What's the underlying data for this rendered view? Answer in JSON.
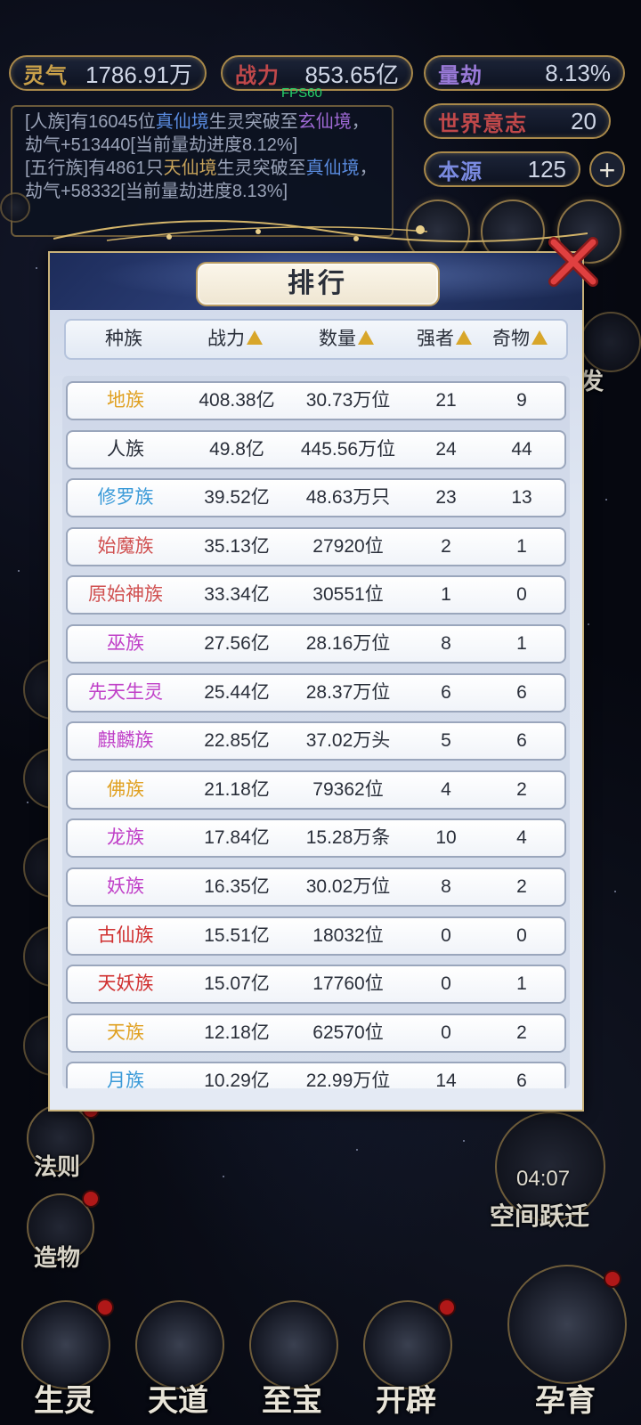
{
  "stats": {
    "lingqi": {
      "label": "灵气",
      "value": "1786.91万",
      "color": "#c8a04a"
    },
    "zhanli": {
      "label": "战力",
      "value": "853.65亿",
      "color": "#c0484a"
    },
    "liangjie": {
      "label": "量劫",
      "value": "8.13%",
      "color": "#9a7ad8"
    },
    "shijieyizhi": {
      "label": "世界意志",
      "value": "20",
      "color": "#c0484a"
    },
    "benyuan": {
      "label": "本源",
      "value": "125",
      "color": "#7a8ae0"
    },
    "fps": "FPS60"
  },
  "log": {
    "line1_a": "[人族]有16045位",
    "line1_b": "真仙境",
    "line1_c": "生灵突破至",
    "line1_d": "玄仙境",
    "line1_e": "，劫气+513440[当前量劫进度8.12%]",
    "line2_a": "[五行族]有4861只",
    "line2_b": "天仙境",
    "line2_c": "生灵突破至",
    "line2_d": "真仙境",
    "line2_e": "，劫气+58332[当前量劫进度8.13%]"
  },
  "side": {
    "fa": "发",
    "fazu": "法则",
    "zaowu": "造物",
    "timer": "04:07",
    "kongjian": "空间跃迁"
  },
  "nav": {
    "shengling": "生灵",
    "tiandao": "天道",
    "zhibao": "至宝",
    "kaipi": "开辟",
    "yunyu": "孕育"
  },
  "dialog": {
    "title": "排行",
    "headers": [
      "种族",
      "战力",
      "数量",
      "强者",
      "奇物"
    ],
    "rows": [
      {
        "name": "地族",
        "color": "#e0a020",
        "power": "408.38亿",
        "count": "30.73万位",
        "strong": "21",
        "items": "9"
      },
      {
        "name": "人族",
        "color": "#2a2f3a",
        "power": "49.8亿",
        "count": "445.56万位",
        "strong": "24",
        "items": "44"
      },
      {
        "name": "修罗族",
        "color": "#3a9ad8",
        "power": "39.52亿",
        "count": "48.63万只",
        "strong": "23",
        "items": "13"
      },
      {
        "name": "始魔族",
        "color": "#d05050",
        "power": "35.13亿",
        "count": "27920位",
        "strong": "2",
        "items": "1"
      },
      {
        "name": "原始神族",
        "color": "#d05050",
        "power": "33.34亿",
        "count": "30551位",
        "strong": "1",
        "items": "0"
      },
      {
        "name": "巫族",
        "color": "#c040c8",
        "power": "27.56亿",
        "count": "28.16万位",
        "strong": "8",
        "items": "1"
      },
      {
        "name": "先天生灵",
        "color": "#c040c8",
        "power": "25.44亿",
        "count": "28.37万位",
        "strong": "6",
        "items": "6"
      },
      {
        "name": "麒麟族",
        "color": "#c040c8",
        "power": "22.85亿",
        "count": "37.02万头",
        "strong": "5",
        "items": "6"
      },
      {
        "name": "佛族",
        "color": "#e0a020",
        "power": "21.18亿",
        "count": "79362位",
        "strong": "4",
        "items": "2"
      },
      {
        "name": "龙族",
        "color": "#c040c8",
        "power": "17.84亿",
        "count": "15.28万条",
        "strong": "10",
        "items": "4"
      },
      {
        "name": "妖族",
        "color": "#c040c8",
        "power": "16.35亿",
        "count": "30.02万位",
        "strong": "8",
        "items": "2"
      },
      {
        "name": "古仙族",
        "color": "#d03030",
        "power": "15.51亿",
        "count": "18032位",
        "strong": "0",
        "items": "0"
      },
      {
        "name": "天妖族",
        "color": "#d03030",
        "power": "15.07亿",
        "count": "17760位",
        "strong": "0",
        "items": "1"
      },
      {
        "name": "天族",
        "color": "#e0a020",
        "power": "12.18亿",
        "count": "62570位",
        "strong": "0",
        "items": "2"
      },
      {
        "name": "月族",
        "color": "#3a9ad8",
        "power": "10.29亿",
        "count": "22.99万位",
        "strong": "14",
        "items": "6"
      }
    ]
  }
}
